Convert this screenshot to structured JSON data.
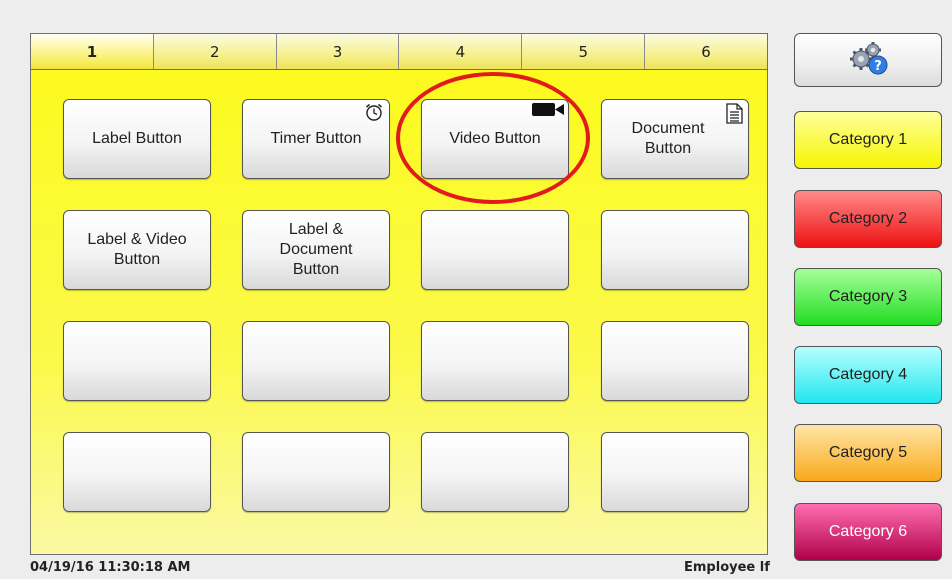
{
  "tabs": [
    "1",
    "2",
    "3",
    "4",
    "5",
    "6"
  ],
  "active_tab": "1",
  "grid": {
    "buttons": [
      {
        "label": "Label Button",
        "icon": ""
      },
      {
        "label": "Timer Button",
        "icon": "alarm-clock-icon"
      },
      {
        "label": "Video Button",
        "icon": "video-camera-icon"
      },
      {
        "label": "Document\nButton",
        "icon": "document-icon"
      },
      {
        "label": "Label & Video\nButton",
        "icon": ""
      },
      {
        "label": "Label &\nDocument\nButton",
        "icon": ""
      },
      {
        "label": "",
        "icon": ""
      },
      {
        "label": "",
        "icon": ""
      },
      {
        "label": "",
        "icon": ""
      },
      {
        "label": "",
        "icon": ""
      },
      {
        "label": "",
        "icon": ""
      },
      {
        "label": "",
        "icon": ""
      },
      {
        "label": "",
        "icon": ""
      },
      {
        "label": "",
        "icon": ""
      },
      {
        "label": "",
        "icon": ""
      },
      {
        "label": "",
        "icon": ""
      }
    ],
    "highlighted": "Video Button",
    "highlight_color": "#e11b1b"
  },
  "settings_icon": "settings-help-icon",
  "categories": [
    {
      "label": "Category 1",
      "top": "#ffff9a",
      "bottom": "#f5f500"
    },
    {
      "label": "Category 2",
      "top": "#ff8a8a",
      "bottom": "#ee1111"
    },
    {
      "label": "Category 3",
      "top": "#a6ff9a",
      "bottom": "#22dd22"
    },
    {
      "label": "Category 4",
      "top": "#b6ffff",
      "bottom": "#22e6ee"
    },
    {
      "label": "Category 5",
      "top": "#ffe6a6",
      "bottom": "#f9a81a"
    },
    {
      "label": "Category 6",
      "top": "#ff6fb0",
      "bottom": "#b0004a"
    }
  ],
  "status": {
    "datetime": "04/19/16  11:30:18 AM",
    "user": "Employee lf"
  }
}
